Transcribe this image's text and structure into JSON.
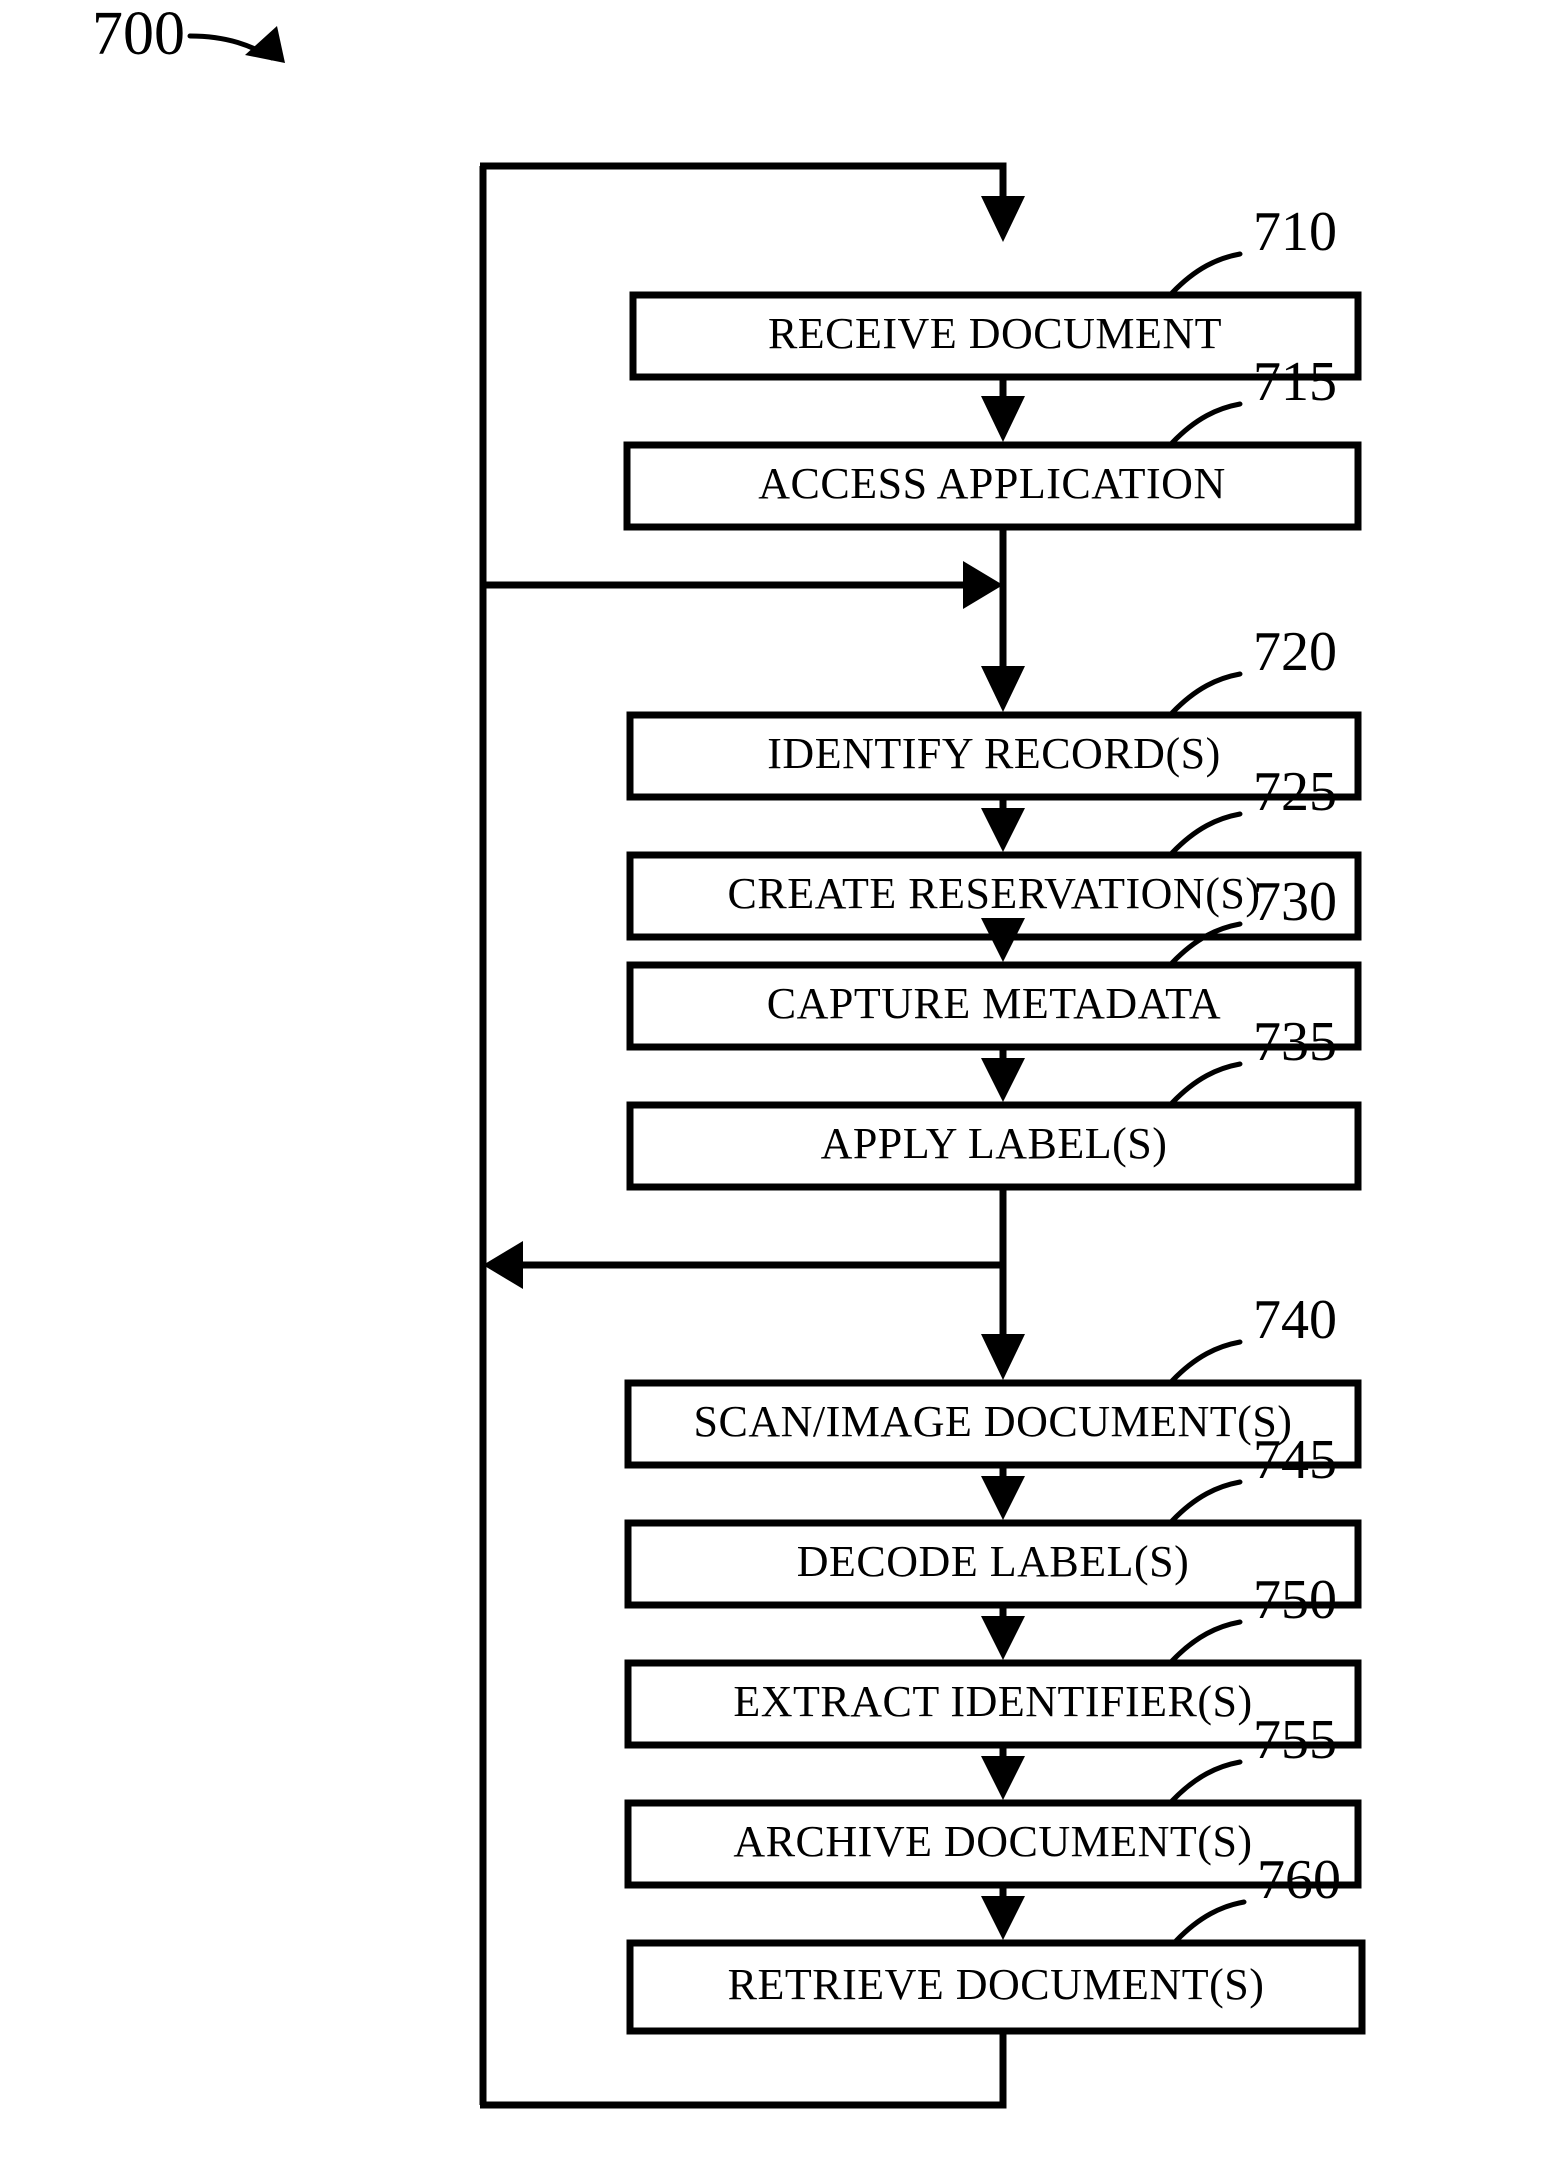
{
  "figure": {
    "number": "700",
    "type": "flowchart",
    "title": "",
    "background_color": "#ffffff",
    "line_color": "#000000"
  },
  "steps": [
    {
      "ref": "710",
      "label": "RECEIVE DOCUMENT"
    },
    {
      "ref": "715",
      "label": "ACCESS APPLICATION"
    },
    {
      "ref": "720",
      "label": "IDENTIFY RECORD(S)"
    },
    {
      "ref": "725",
      "label": "CREATE RESERVATION(S)"
    },
    {
      "ref": "730",
      "label": "CAPTURE METADATA"
    },
    {
      "ref": "735",
      "label": "APPLY LABEL(S)"
    },
    {
      "ref": "740",
      "label": "SCAN/IMAGE DOCUMENT(S)"
    },
    {
      "ref": "745",
      "label": "DECODE LABEL(S)"
    },
    {
      "ref": "750",
      "label": "EXTRACT IDENTIFIER(S)"
    },
    {
      "ref": "755",
      "label": "ARCHIVE DOCUMENT(S)"
    },
    {
      "ref": "760",
      "label": "RETRIEVE DOCUMENT(S)"
    }
  ],
  "connectors": [
    {
      "name": "top-entry-into-receive-document",
      "kind": "arrow-down"
    },
    {
      "name": "receive-document-to-access-application",
      "kind": "arrow-down"
    },
    {
      "name": "branch-in-to-identify-records",
      "kind": "arrow-right"
    },
    {
      "name": "access-application-to-identify-records",
      "kind": "arrow-down"
    },
    {
      "name": "identify-records-to-create-reservations",
      "kind": "arrow-down"
    },
    {
      "name": "create-reservations-to-capture-metadata",
      "kind": "arrow-down"
    },
    {
      "name": "capture-metadata-to-apply-labels",
      "kind": "arrow-down"
    },
    {
      "name": "branch-out-from-apply-labels",
      "kind": "arrow-left"
    },
    {
      "name": "apply-labels-to-scan-image-documents",
      "kind": "arrow-down"
    },
    {
      "name": "scan-image-documents-to-decode-labels",
      "kind": "arrow-down"
    },
    {
      "name": "decode-labels-to-extract-identifiers",
      "kind": "arrow-down"
    },
    {
      "name": "extract-identifiers-to-archive-documents",
      "kind": "arrow-down"
    },
    {
      "name": "archive-documents-to-retrieve-documents",
      "kind": "arrow-down"
    },
    {
      "name": "retrieve-documents-feedback-loop-to-top",
      "kind": "loop"
    }
  ]
}
